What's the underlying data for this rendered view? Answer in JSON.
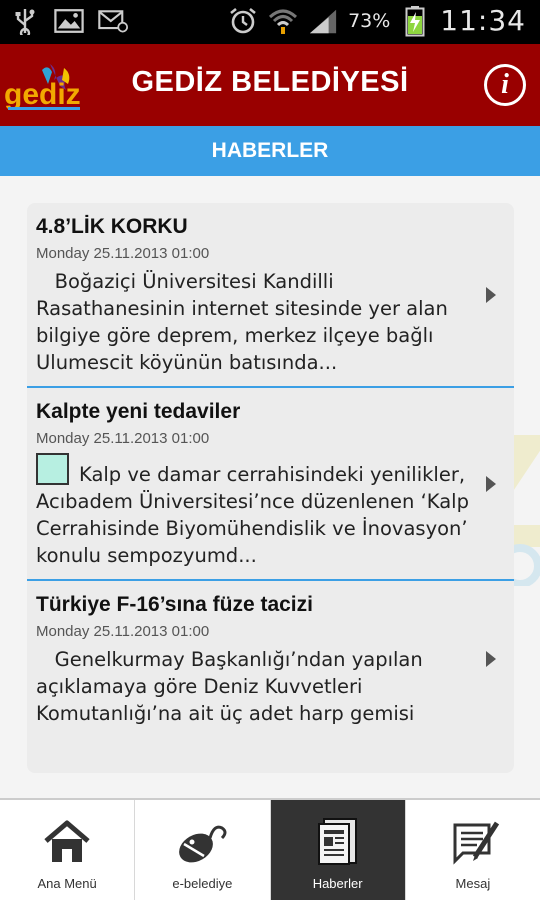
{
  "status_bar": {
    "battery_percent": "73%",
    "time": "11:34",
    "icons": [
      "usb-icon",
      "image-icon",
      "email-icon",
      "alarm-icon",
      "wifi-icon",
      "signal-icon",
      "battery-charging-icon"
    ]
  },
  "header": {
    "logo_text": "gediz",
    "title": "GEDİZ BELEDİYESİ",
    "info_icon": "info-icon",
    "background_color": "#990000"
  },
  "section": {
    "title": "HABERLER",
    "background_color": "#3b9fe5"
  },
  "news": [
    {
      "title": "4.8’LİK KORKU",
      "date": "Monday 25.11.2013 01:00",
      "body": "Boğaziçi Üniversitesi Kandilli Rasathanesinin internet sitesinde yer alan bilgiye göre deprem, merkez ilçeye bağlı Ulumescit köyünün batısında..."
    },
    {
      "title": "Kalpte yeni  tedaviler",
      "date": "Monday 25.11.2013 01:00",
      "body": "Kalp ve damar cerrahisindeki yenilikler, Acıbadem Üniversitesi’nce düzenlenen ‘Kalp Cerrahisinde Biyomühendislik ve İnovasyon’ konulu sempozyumd..."
    },
    {
      "title": "Türkiye F-16’sına füze tacizi",
      "date": "Monday 25.11.2013 01:00",
      "body": "Genelkurmay Başkanlığı’ndan yapılan açıklamaya göre Deniz Kuvvetleri Komutanlığı’na ait üç adet harp gemisi"
    }
  ],
  "bottom_nav": [
    {
      "label": "Ana Menü",
      "icon": "home-icon",
      "active": false
    },
    {
      "label": "e-belediye",
      "icon": "mouse-icon",
      "active": false
    },
    {
      "label": "Haberler",
      "icon": "newspaper-icon",
      "active": true
    },
    {
      "label": "Mesaj",
      "icon": "message-icon",
      "active": false
    }
  ]
}
